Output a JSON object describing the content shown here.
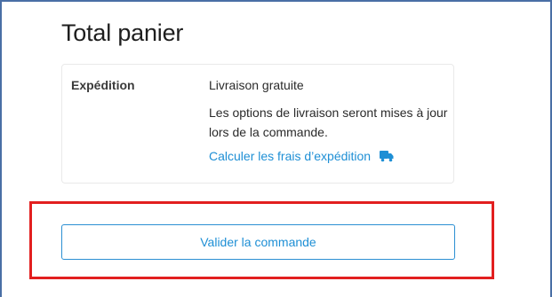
{
  "cart_totals": {
    "title": "Total panier",
    "shipping": {
      "label": "Expédition",
      "method": "Livraison gratuite",
      "note": "Les options de livraison seront mises à jour lors de la commande.",
      "calculate_link": "Calculer les frais d’expédition",
      "calculate_icon": "truck-icon"
    },
    "checkout_button": "Valider la commande"
  },
  "colors": {
    "link": "#1e8fd5",
    "highlight": "#e21f1f",
    "frame": "#4a6fa5"
  }
}
